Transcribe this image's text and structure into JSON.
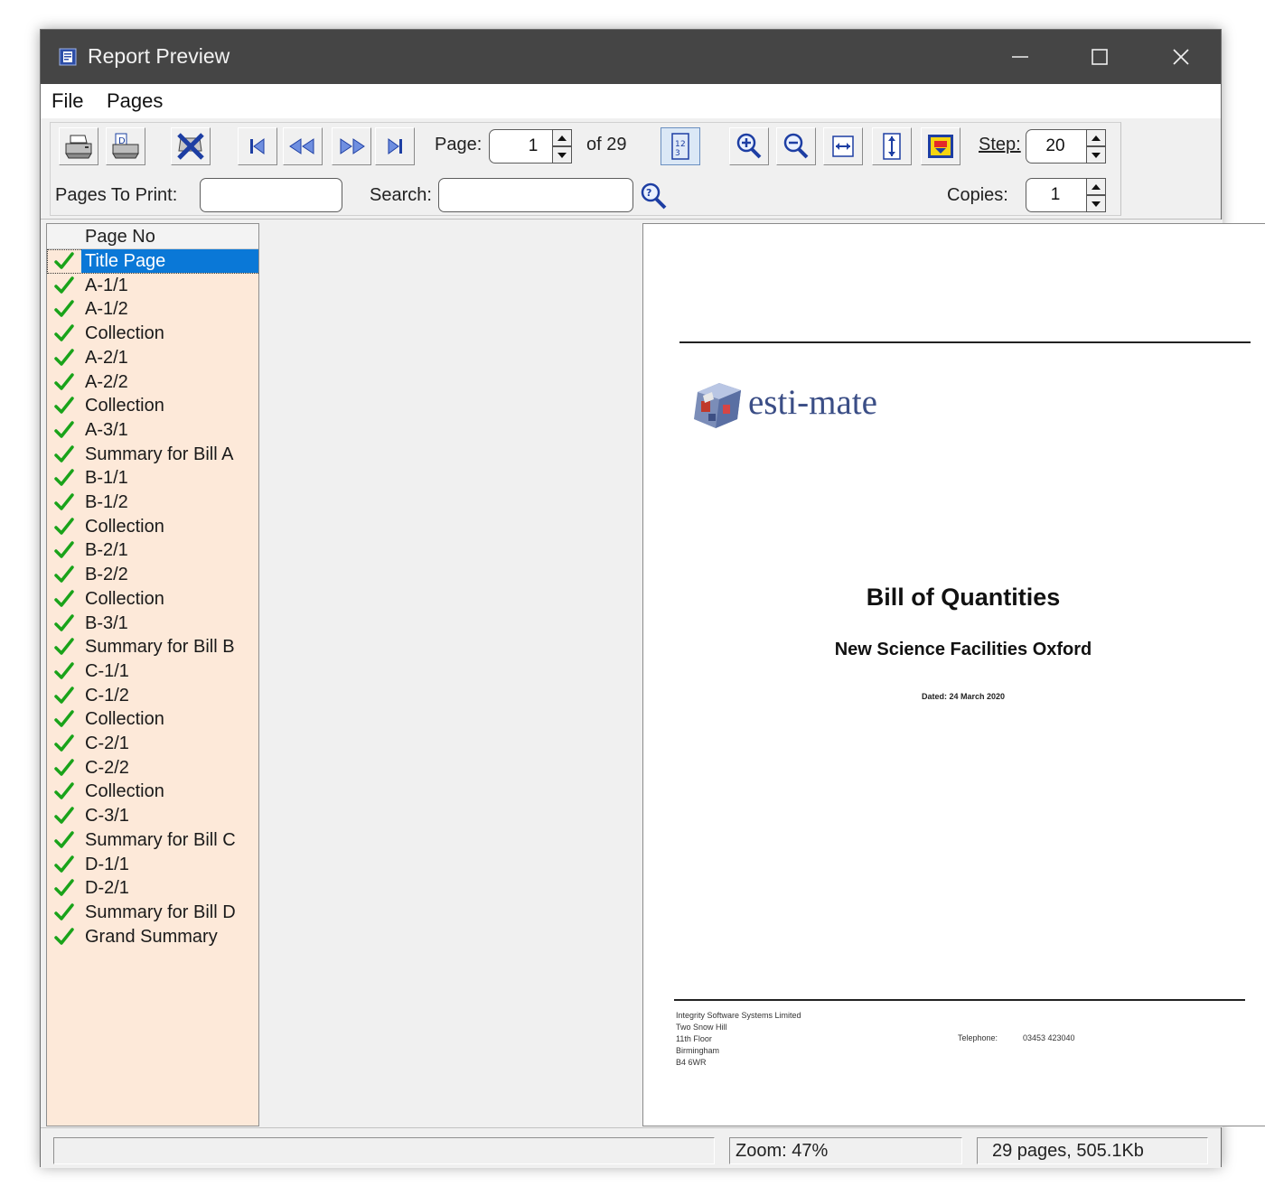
{
  "window": {
    "title": "Report Preview"
  },
  "menu": {
    "file": "File",
    "pages": "Pages"
  },
  "toolbar": {
    "page_label": "Page:",
    "page_value": "1",
    "of_label": "of 29",
    "step_label": "Step:",
    "step_value": "20",
    "pages_to_print_label": "Pages To Print:",
    "pages_to_print_value": "",
    "search_label": "Search:",
    "search_value": "",
    "copies_label": "Copies:",
    "copies_value": "1"
  },
  "page_list": {
    "header": "Page No",
    "items": [
      "Title Page",
      "A-1/1",
      "A-1/2",
      "Collection",
      "A-2/1",
      "A-2/2",
      "Collection",
      "A-3/1",
      "Summary for Bill A",
      "B-1/1",
      "B-1/2",
      "Collection",
      "B-2/1",
      "B-2/2",
      "Collection",
      "B-3/1",
      "Summary for Bill B",
      "C-1/1",
      "C-1/2",
      "Collection",
      "C-2/1",
      "C-2/2",
      "Collection",
      "C-3/1",
      "Summary for Bill C",
      "D-1/1",
      "D-2/1",
      "Summary for Bill D",
      "Grand Summary"
    ],
    "selected_index": 0
  },
  "document": {
    "logo_text": "esti-mate",
    "title": "Bill of Quantities",
    "subtitle": "New Science Facilities Oxford",
    "date_line": "Dated: 24 March 2020",
    "footer_lines": [
      "Integrity Software Systems Limited",
      "Two Snow Hill",
      "11th Floor",
      "Birmingham",
      "B4 6WR"
    ],
    "telephone_label": "Telephone:",
    "telephone_value": "03453 423040"
  },
  "status": {
    "zoom": "Zoom: 47%",
    "info": "29 pages, 505.1Kb"
  },
  "colors": {
    "titlebar": "#454545",
    "page_list_bg": "#fde9d9",
    "selection": "#0a78d7",
    "check": "#1aa31a",
    "logo_text": "#3b4e86"
  }
}
